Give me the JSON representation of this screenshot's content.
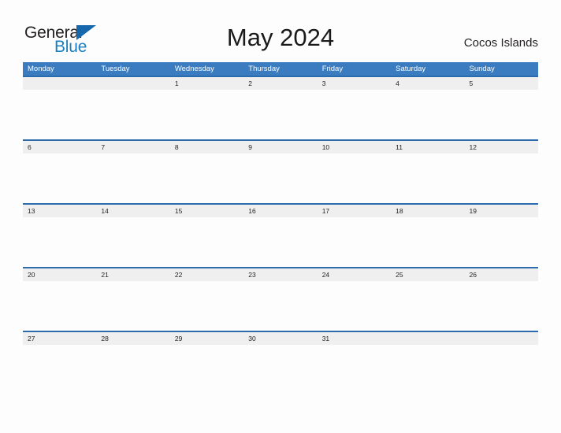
{
  "brand": {
    "name_part1": "General",
    "name_part2": "Blue",
    "flag_icon": "triangle-flag-icon",
    "colors": {
      "part1": "#231f20",
      "part2": "#1a7fc1",
      "flag": "#1667ab"
    }
  },
  "header": {
    "title": "May 2024",
    "location": "Cocos Islands"
  },
  "theme": {
    "header_bar": "#3b7cc0",
    "row_band": "#efefef",
    "row_rule": "#2c6cad",
    "page_background": "#fdfdfd",
    "text": "#231f20"
  },
  "calendar": {
    "month": "May",
    "year": "2024",
    "week_start": "Monday",
    "weekdays": [
      "Monday",
      "Tuesday",
      "Wednesday",
      "Thursday",
      "Friday",
      "Saturday",
      "Sunday"
    ],
    "weeks": [
      [
        "",
        "",
        "1",
        "2",
        "3",
        "4",
        "5"
      ],
      [
        "6",
        "7",
        "8",
        "9",
        "10",
        "11",
        "12"
      ],
      [
        "13",
        "14",
        "15",
        "16",
        "17",
        "18",
        "19"
      ],
      [
        "20",
        "21",
        "22",
        "23",
        "24",
        "25",
        "26"
      ],
      [
        "27",
        "28",
        "29",
        "30",
        "31",
        "",
        ""
      ]
    ]
  }
}
